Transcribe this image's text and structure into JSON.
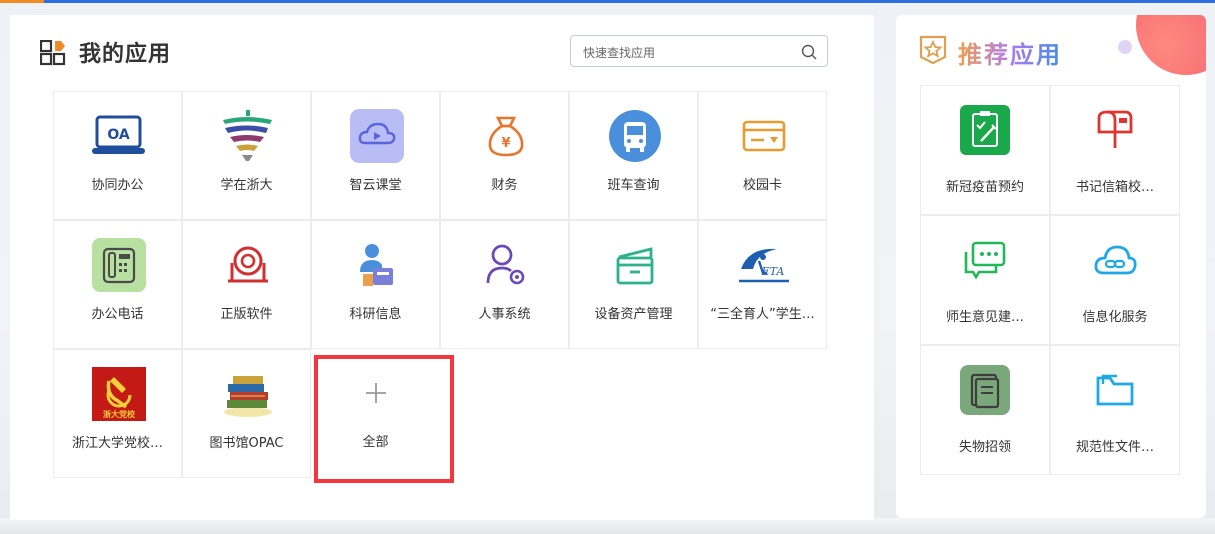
{
  "my_apps": {
    "title": "我的应用",
    "search_placeholder": "快速查找应用",
    "apps": [
      {
        "label": "协同办公",
        "icon": "oa-laptop-icon"
      },
      {
        "label": "学在浙大",
        "icon": "xuezai-zheda-logo-icon"
      },
      {
        "label": "智云课堂",
        "icon": "cloud-play-icon"
      },
      {
        "label": "财务",
        "icon": "money-bag-icon"
      },
      {
        "label": "班车查询",
        "icon": "bus-icon"
      },
      {
        "label": "校园卡",
        "icon": "campus-card-icon"
      },
      {
        "label": "办公电话",
        "icon": "office-phone-icon"
      },
      {
        "label": "正版软件",
        "icon": "software-disc-icon"
      },
      {
        "label": "科研信息",
        "icon": "research-person-icon"
      },
      {
        "label": "人事系统",
        "icon": "user-settings-icon"
      },
      {
        "label": "设备资产管理",
        "icon": "asset-box-icon"
      },
      {
        "label": "“三全育人”学生…",
        "icon": "eta-logo-icon"
      },
      {
        "label": "浙江大学党校…",
        "icon": "party-school-emblem-icon"
      },
      {
        "label": "图书馆OPAC",
        "icon": "books-stack-icon"
      }
    ],
    "all_label": "全部",
    "emblem_text": "浙大党校"
  },
  "recommended": {
    "title": "推荐应用",
    "apps": [
      {
        "label": "新冠疫苗预约",
        "icon": "vaccine-clipboard-icon"
      },
      {
        "label": "书记信箱校…",
        "icon": "mailbox-icon"
      },
      {
        "label": "师生意见建…",
        "icon": "chat-bubbles-icon"
      },
      {
        "label": "信息化服务",
        "icon": "cloud-link-icon"
      },
      {
        "label": "失物招领",
        "icon": "lost-found-icon"
      },
      {
        "label": "规范性文件…",
        "icon": "folder-icon"
      }
    ]
  },
  "colors": {
    "highlight_border": "#f2383e",
    "top_bar": "#2f6fe0",
    "rec_title_gradient": [
      "#f0a04a",
      "#b07af0",
      "#3e8fe8"
    ]
  }
}
